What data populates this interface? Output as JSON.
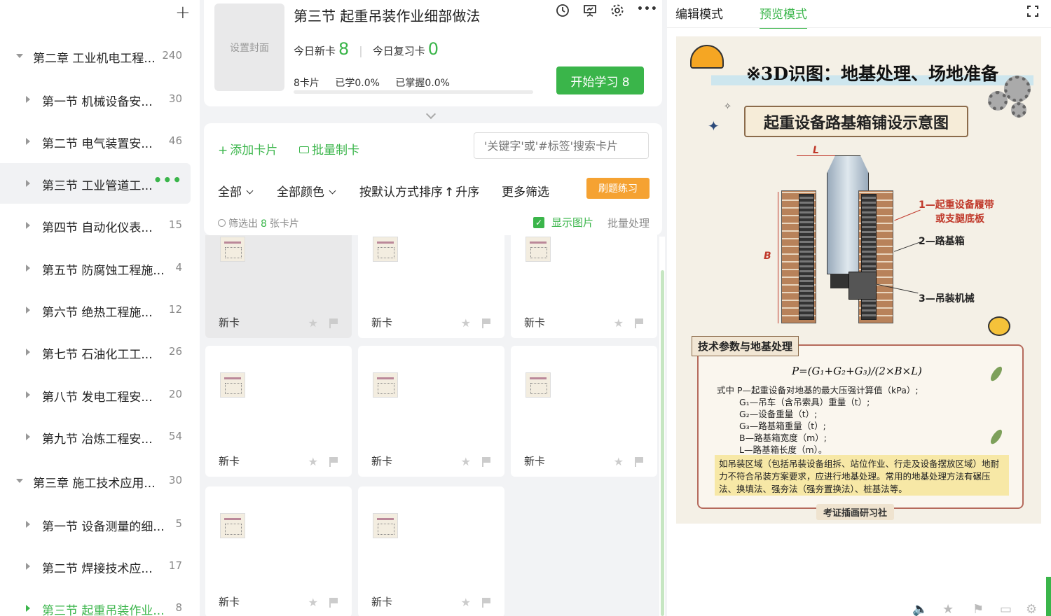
{
  "sidebar": {
    "add_label": "+",
    "items": [
      {
        "name": "第二章 工业机电工程...",
        "count": "240",
        "level": 1
      },
      {
        "name": "第一节 机械设备安...",
        "count": "30",
        "level": 2
      },
      {
        "name": "第二节 电气装置安...",
        "count": "46",
        "level": 2
      },
      {
        "name": "第三节 工业管道工...",
        "count": "",
        "level": 2,
        "more": "•••"
      },
      {
        "name": "第四节 自动化仪表...",
        "count": "15",
        "level": 2
      },
      {
        "name": "第五节 防腐蚀工程施...",
        "count": "4",
        "level": 2
      },
      {
        "name": "第六节 绝热工程施...",
        "count": "12",
        "level": 2
      },
      {
        "name": "第七节 石油化工工...",
        "count": "26",
        "level": 2
      },
      {
        "name": "第八节 发电工程安...",
        "count": "20",
        "level": 2
      },
      {
        "name": "第九节 冶炼工程安...",
        "count": "54",
        "level": 2
      },
      {
        "name": "第三章 施工技术应用...",
        "count": "30",
        "level": 1
      },
      {
        "name": "第一节 设备测量的细...",
        "count": "5",
        "level": 2
      },
      {
        "name": "第二节 焊接技术应...",
        "count": "17",
        "level": 2
      },
      {
        "name": "第三节 起重吊装作业...",
        "count": "8",
        "level": 2
      }
    ]
  },
  "header": {
    "cover_label": "设置封面",
    "title": "第三节 起重吊装作业细部做法",
    "icons": [
      "clock-icon",
      "presentation-icon",
      "gear-icon",
      "more-icon"
    ],
    "new_today_label": "今日新卡",
    "new_today_value": "8",
    "review_today_label": "今日复习卡",
    "review_today_value": "0",
    "cards_count": "8卡片",
    "learned": "已学0.0%",
    "mastered": "已掌握0.0%",
    "start_button": "开始学习 8"
  },
  "toolbar": {
    "add_card": "添加卡片",
    "batch_make": "批量制卡",
    "search_placeholder": "'关键字'或'#标签'搜索卡片",
    "filter_all": "全部",
    "filter_color": "全部颜色",
    "sort": "按默认方式排序",
    "sort_order": "升序",
    "more_filters": "更多筛选",
    "practice_button": "刷题练习",
    "filter_result_prefix": "筛选出",
    "filter_result_count": "8",
    "filter_result_suffix": "张卡片",
    "show_images": "显示图片",
    "batch_process": "批量处理"
  },
  "cards": [
    {
      "label": "新卡"
    },
    {
      "label": "新卡"
    },
    {
      "label": "新卡"
    },
    {
      "label": "新卡"
    },
    {
      "label": "新卡"
    },
    {
      "label": "新卡"
    },
    {
      "label": "新卡"
    },
    {
      "label": "新卡"
    }
  ],
  "preview": {
    "tab_edit": "编辑模式",
    "tab_preview": "预览模式",
    "poster": {
      "title": "※3D识图：地基处理、场地准备",
      "subtitle": "起重设备路基箱铺设示意图",
      "dim_L": "L",
      "dim_B": "B",
      "callout_1a": "1—起重设备履带",
      "callout_1b": "或支腿底板",
      "callout_2": "2—路基箱",
      "callout_3": "3—吊装机械",
      "param_title": "技术参数与地基处理",
      "formula": "P=(G₁+G₂+G₃)/(2×B×L)",
      "vars": [
        "式中 P—起重设备对地基的最大压强计算值（kPa）;",
        "G₁—吊车（含吊索具）重量（t）;",
        "G₂—设备重量（t）;",
        "G₃—路基箱重量（t）;",
        "B—路基箱宽度（m）;",
        "L—路基箱长度（m）。"
      ],
      "note": "如吊装区域（包括吊装设备组拆、站位作业、行走及设备摆放区域）地耐力不符合吊装方案要求，应进行地基处理。常用的地基处理方法有碾压法、换填法、强夯法（强夯置换法）、桩基法等。",
      "credit": "考证插画研习社"
    }
  },
  "colors": {
    "accent": "#3ab54a",
    "practice": "#f5a232"
  }
}
